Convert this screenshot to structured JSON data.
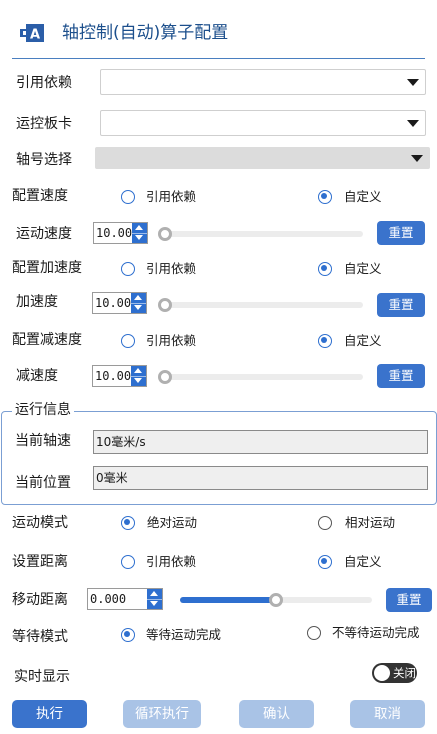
{
  "title": "轴控制(自动)算子配置",
  "fields": {
    "ref_dependency": {
      "label": "引用依赖",
      "value": ""
    },
    "motion_card": {
      "label": "运控板卡",
      "value": ""
    },
    "axis_select": {
      "label": "轴号选择",
      "value": ""
    }
  },
  "speed": {
    "config_label": "配置速度",
    "option_ref": "引用依赖",
    "option_custom": "自定义",
    "selected": "自定义",
    "value_label": "运动速度",
    "value": "10.00",
    "slider_level": 0,
    "reset_label": "重置"
  },
  "accel": {
    "config_label": "配置加速度",
    "option_ref": "引用依赖",
    "option_custom": "自定义",
    "selected": "自定义",
    "value_label": "加速度",
    "value": "10.00",
    "slider_level": 0,
    "reset_label": "重置"
  },
  "decel": {
    "config_label": "配置减速度",
    "option_ref": "引用依赖",
    "option_custom": "自定义",
    "selected": "自定义",
    "value_label": "减速度",
    "value": "10.00",
    "slider_level": 0,
    "reset_label": "重置"
  },
  "run_info": {
    "title": "运行信息",
    "speed_label": "当前轴速",
    "speed_value": "10毫米/s",
    "position_label": "当前位置",
    "position_value": "0毫米"
  },
  "motion_mode": {
    "label": "运动模式",
    "option_absolute": "绝对运动",
    "option_relative": "相对运动",
    "selected": "绝对运动"
  },
  "distance_setting": {
    "label": "设置距离",
    "option_ref": "引用依赖",
    "option_custom": "自定义",
    "selected": "自定义"
  },
  "move_distance": {
    "label": "移动距离",
    "value": "0.000",
    "slider_level": 0.5,
    "reset_label": "重置"
  },
  "wait_mode": {
    "label": "等待模式",
    "option_wait": "等待运动完成",
    "option_nowait": "不等待运动完成",
    "selected": "等待运动完成"
  },
  "realtime": {
    "label": "实时显示",
    "toggle_label": "关闭",
    "on": false
  },
  "actions": {
    "execute": "执行",
    "loop_execute": "循环执行",
    "confirm": "确认",
    "cancel": "取消"
  },
  "colors": {
    "accent": "#2e6fcf",
    "button": "#3a73cc",
    "button_disabled": "#a9c3e6",
    "title": "#1c4f8c"
  }
}
